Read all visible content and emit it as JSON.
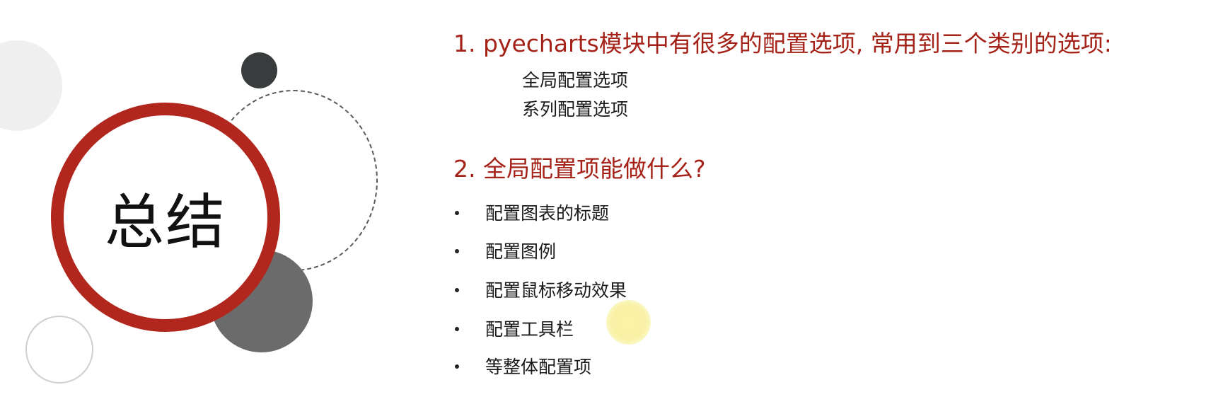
{
  "center_title": "总结",
  "section1": {
    "heading": "1. pyecharts模块中有很多的配置选项, 常用到三个类别的选项:",
    "items": [
      "全局配置选项",
      "系列配置选项"
    ]
  },
  "section2": {
    "heading": "2. 全局配置项能做什么?",
    "bullets": [
      "配置图表的标题",
      "配置图例",
      "配置鼠标移动效果",
      "配置工具栏",
      "等整体配置项"
    ]
  },
  "colors": {
    "accent": "#b1261d",
    "heading": "#a52218",
    "text": "#1a1a1a",
    "dark_circle": "#393c3d",
    "gray_circle": "#6b6b6b"
  }
}
